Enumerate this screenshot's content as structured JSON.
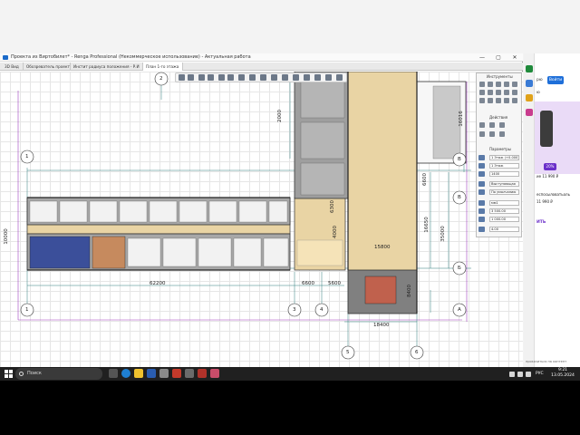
{
  "window": {
    "title": "Проекта из Виртобилет* - Renga Professional (Некоммерческое использование) - Актуальная работа",
    "min": "—",
    "max": "▢",
    "close": "✕"
  },
  "tabs": [
    {
      "label": "3D Вид"
    },
    {
      "label": "Обозреватель проекта"
    },
    {
      "label": "Инстит радиуса положения - Р.И"
    },
    {
      "label": "План 1-го этажа"
    }
  ],
  "panel": {
    "tools_title": "Инструменты",
    "actions_title": "Действия",
    "params_title": "Параметры",
    "fields": [
      "1 Этаж (+0.000)",
      "1 Этаж",
      "1400",
      "Выступающая",
      "По умолчанию",
      "мм1",
      "3 500.00",
      "1 000.00",
      "4.00"
    ]
  },
  "drawing": {
    "axes_bottom": [
      "1",
      "3",
      "4",
      "A"
    ],
    "axes_left": [
      "1",
      "1"
    ],
    "axes_top": [
      "2"
    ],
    "axes_right": [
      "B",
      "Б",
      "В"
    ],
    "axes_bottom2": [
      "5",
      "6"
    ],
    "dims": {
      "d62200": "62200",
      "d6600": "6600",
      "d5600": "5600",
      "d18400": "18400",
      "d15800": "15800",
      "d35000": "35000",
      "d16650": "16650",
      "d6600v": "6600",
      "d10000": "10000",
      "d16016": "16016",
      "d6300": "6300",
      "d4000": "4000",
      "d2000": "2000",
      "d4000b": "4000",
      "d8400": "8400"
    }
  },
  "browser": {
    "top_btn": "Войти",
    "side_letters": [
      "рю",
      "ю"
    ],
    "promo1": "20%",
    "promo_text1": "ие 11 990 ₽",
    "promo_text2": "еспосыловатьоль",
    "promo_text3": "11 990 ₽",
    "link": "ИТЬ",
    "bottom": "прокачиться на контент"
  },
  "taskbar": {
    "search": "Поиск",
    "lang": "РУС",
    "time": "9:21",
    "date": "13.05.2024"
  },
  "colors": {
    "sand": "#e9d4a4",
    "grey_room": "#9e9e9e",
    "grid": "#e6e6e6",
    "axis_purple": "#a13fbf",
    "dim_teal": "#2f7d7d"
  }
}
